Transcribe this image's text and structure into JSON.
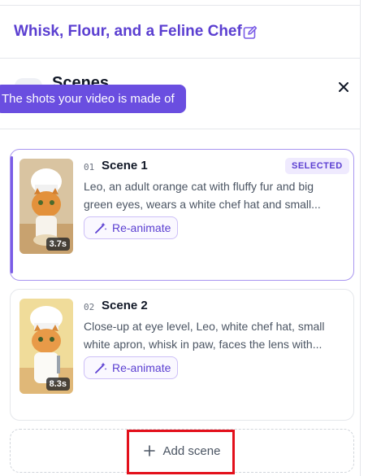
{
  "project": {
    "title": "Whisk, Flour, and a Feline Chef"
  },
  "panel": {
    "title": "Scenes",
    "tooltip": "The shots your video is made of"
  },
  "scenes": [
    {
      "number": "01",
      "title": "Scene 1",
      "badge": "SELECTED",
      "description_line1": "Leo, an adult orange cat with fluffy fur and big",
      "description_line2": "green eyes, wears a white chef hat and small...",
      "duration": "3.7s",
      "action": "Re-animate"
    },
    {
      "number": "02",
      "title": "Scene 2",
      "description_line1": "Close-up at eye level, Leo, white chef hat, small",
      "description_line2": "white apron, whisk in paw, faces the lens with...",
      "duration": "8.3s",
      "action": "Re-animate"
    }
  ],
  "add_scene": {
    "label": "Add scene"
  },
  "colors": {
    "accent": "#6a4ee0",
    "title": "#5b3fd1",
    "highlight": "#e3101b"
  }
}
